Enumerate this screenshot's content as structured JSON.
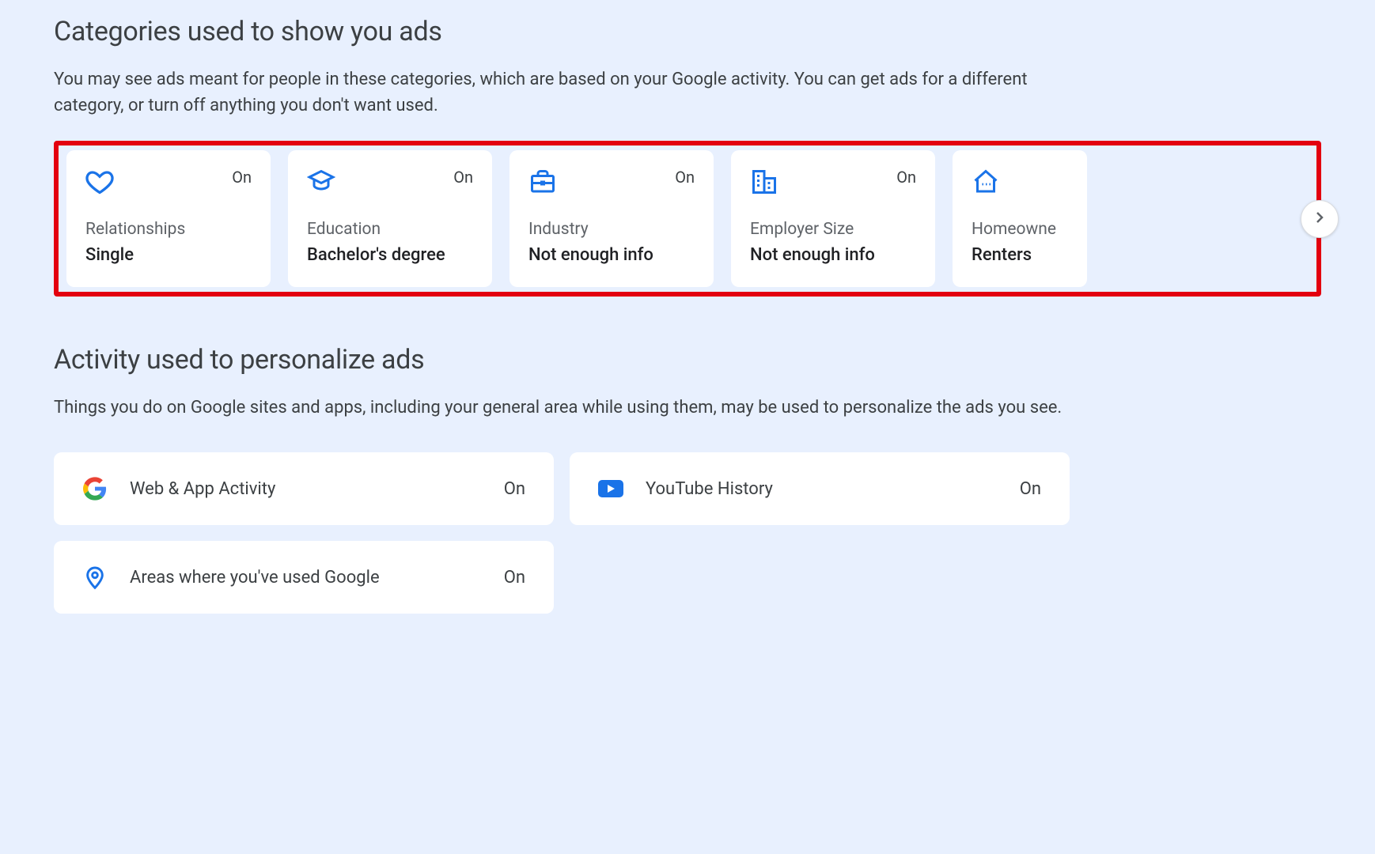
{
  "categories_section": {
    "title": "Categories used to show you ads",
    "description": "You may see ads meant for people in these categories, which are based on your Google activity. You can get ads for a different category, or turn off anything you don't want used.",
    "cards": [
      {
        "icon": "heart",
        "status": "On",
        "label": "Relationships",
        "value": "Single"
      },
      {
        "icon": "graduation",
        "status": "On",
        "label": "Education",
        "value": "Bachelor's degree"
      },
      {
        "icon": "briefcase",
        "status": "On",
        "label": "Industry",
        "value": "Not enough info"
      },
      {
        "icon": "buildings",
        "status": "On",
        "label": "Employer Size",
        "value": "Not enough info"
      },
      {
        "icon": "house",
        "status": "",
        "label": "Homeowne",
        "value": "Renters"
      }
    ]
  },
  "activity_section": {
    "title": "Activity used to personalize ads",
    "description": "Things you do on Google sites and apps, including your general area while using them, may be used to personalize the ads you see.",
    "items": [
      {
        "icon": "google",
        "label": "Web & App Activity",
        "status": "On"
      },
      {
        "icon": "youtube",
        "label": "YouTube History",
        "status": "On"
      },
      {
        "icon": "location",
        "label": "Areas where you've used Google",
        "status": "On"
      }
    ]
  },
  "colors": {
    "accent": "#1a73e8",
    "highlight": "#e3000f"
  }
}
